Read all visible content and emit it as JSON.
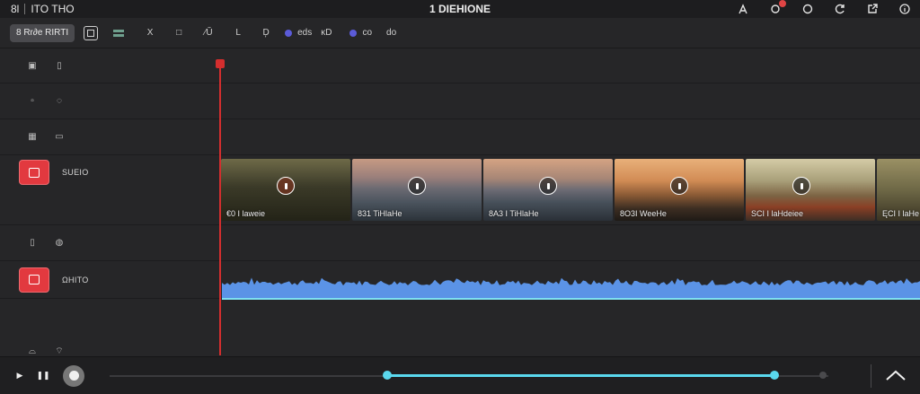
{
  "titlebar": {
    "left_label_a": "8l",
    "left_label_b": "ITO THO",
    "title": "1 DIEHIONE"
  },
  "toolbar": {
    "main_button": "8 Rr∂e RIRTI",
    "tools": [
      "X",
      "□",
      "⁄Ŭ",
      "L",
      "D̦"
    ],
    "tag_1": "eds",
    "tag_1_extra": "ĸD",
    "tag_2": "co",
    "tag_2_extra": "do"
  },
  "tracks": [
    {
      "name": "empty-1",
      "label": ""
    },
    {
      "name": "empty-2",
      "label": ""
    },
    {
      "name": "empty-3",
      "label": ""
    },
    {
      "name": "video",
      "label": "SUEIO"
    },
    {
      "name": "empty-4",
      "label": ""
    },
    {
      "name": "audio",
      "label": "ΩHITO"
    },
    {
      "name": "empty-5",
      "label": ""
    }
  ],
  "clips": [
    {
      "label": "€0 I laweie"
    },
    {
      "label": "831 TiHlaHe"
    },
    {
      "label": "8A3 I TiHlaHe"
    },
    {
      "label": "8O3I WeeHe"
    },
    {
      "label": "SCI I laHdeiee"
    },
    {
      "label": "ĘCI I laHe"
    }
  ],
  "transport": {
    "progress_start": 0.385,
    "progress_end": 0.924
  },
  "colors": {
    "accent_red": "#e2393f",
    "playhead": "#d42e2e",
    "audio_wave": "#5b93e6",
    "progress": "#5ad8ee",
    "background": "#262628"
  }
}
